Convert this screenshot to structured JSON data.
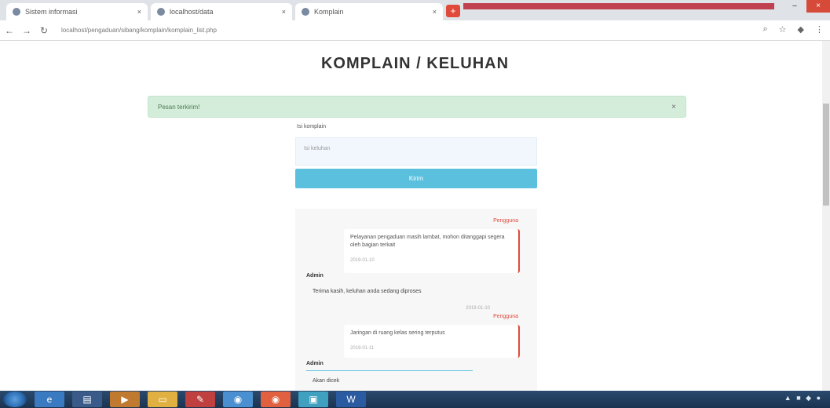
{
  "browser": {
    "tabs": [
      {
        "label": "Sistem informasi"
      },
      {
        "label": "localhost/data"
      },
      {
        "label": "Komplain"
      }
    ],
    "new_tab_label": "+",
    "url": "localhost/pengaduan/sibang/komplain/komplain_list.php",
    "nav": {
      "back": "←",
      "forward": "→",
      "reload": "↻"
    },
    "toolbar_icons": [
      "zoom-icon",
      "star-icon",
      "extension-icon",
      "menu-icon"
    ]
  },
  "page": {
    "title": "KOMPLAIN / KELUHAN",
    "alert": {
      "text": "Pesan terkirim!",
      "close": "×"
    },
    "form": {
      "label": "Isi komplain",
      "placeholder": "Isi keluhan",
      "submit_label": "Kirim"
    },
    "messages": [
      {
        "sender": "Pengguna",
        "text": "Pelayanan pengaduan masih lambat, mohon ditanggapi segera oleh bagian terkait",
        "meta": "2019-01-10"
      },
      {
        "sender": "Pengguna",
        "text": "Jaringan di ruang kelas sering terputus",
        "meta": "2019-01-11"
      }
    ],
    "replies": [
      {
        "label": "Admin",
        "text": "Terima kasih, keluhan anda sedang diproses",
        "meta": "2019-01-10"
      },
      {
        "label": "Admin",
        "text": "Akan dicek"
      }
    ]
  },
  "taskbar": {
    "items": [
      "ie-icon",
      "explorer-icon",
      "media-icon",
      "folder-icon",
      "paint-icon",
      "chrome-icon",
      "chrome-icon-2",
      "app-icon",
      "word-icon"
    ],
    "tray": "▲ ■ ◆ ●"
  },
  "colors": {
    "accent": "#5bc0de",
    "alert_bg": "#d4edda",
    "sender_red": "#e04a3a",
    "taskbar": "#1b3350"
  }
}
